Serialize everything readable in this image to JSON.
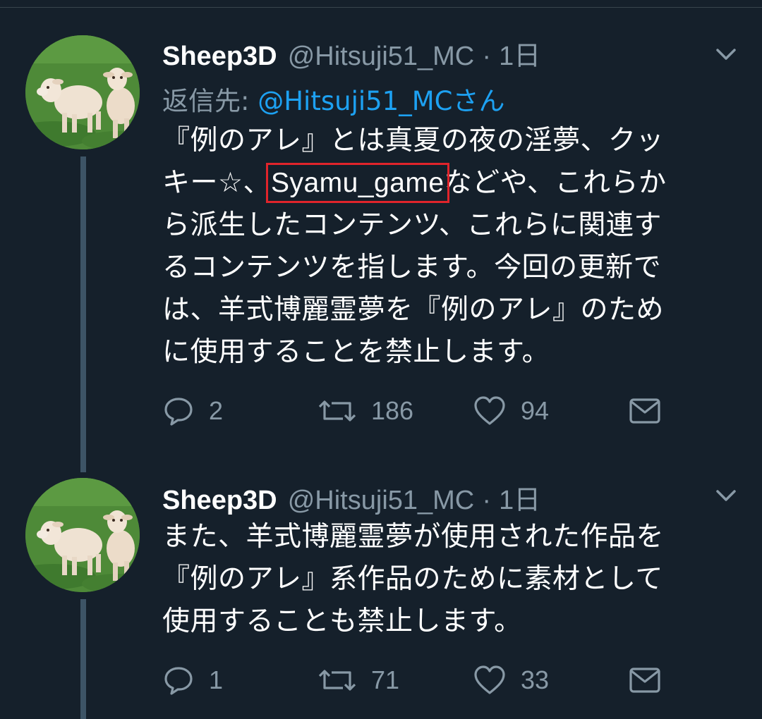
{
  "tweets": [
    {
      "name": "Sheep3D",
      "handle": "@Hitsuji51_MC",
      "time_sep": "·",
      "time": "1日",
      "reply_label": "返信先:",
      "reply_to": "@Hitsuji51_MCさん",
      "body_lines": [
        {
          "pre": "『例のアレ』とは真夏の夜の淫夢、クッ",
          "hl": "",
          "post": ""
        },
        {
          "pre": "キー☆、",
          "hl": "Syamu_game",
          "post": "などや、これらか"
        },
        {
          "pre": "ら派生したコンテンツ、これらに関連す",
          "hl": "",
          "post": ""
        },
        {
          "pre": "るコンテンツを指します。今回の更新で",
          "hl": "",
          "post": ""
        },
        {
          "pre": "は、羊式博麗霊夢を『例のアレ』のため",
          "hl": "",
          "post": ""
        },
        {
          "pre": "に使用することを禁止します。",
          "hl": "",
          "post": ""
        }
      ],
      "replies": "2",
      "retweets": "186",
      "likes": "94"
    },
    {
      "name": "Sheep3D",
      "handle": "@Hitsuji51_MC",
      "time_sep": "·",
      "time": "1日",
      "body_lines": [
        {
          "pre": "また、羊式博麗霊夢が使用された作品を",
          "hl": "",
          "post": ""
        },
        {
          "pre": "『例のアレ』系作品のために素材として",
          "hl": "",
          "post": ""
        },
        {
          "pre": "使用することも禁止します。",
          "hl": "",
          "post": ""
        }
      ],
      "replies": "1",
      "retweets": "71",
      "likes": "33"
    }
  ],
  "icons": {
    "reply": "speech-bubble-icon",
    "retweet": "retweet-arrows-icon",
    "like": "heart-icon",
    "dm": "envelope-icon",
    "menu": "chevron-down-icon"
  },
  "colors": {
    "background": "#15202b",
    "secondary_text": "#8899a6",
    "link": "#1da1f2",
    "highlight_box": "#e0242b",
    "thread_line": "#3d5466"
  }
}
